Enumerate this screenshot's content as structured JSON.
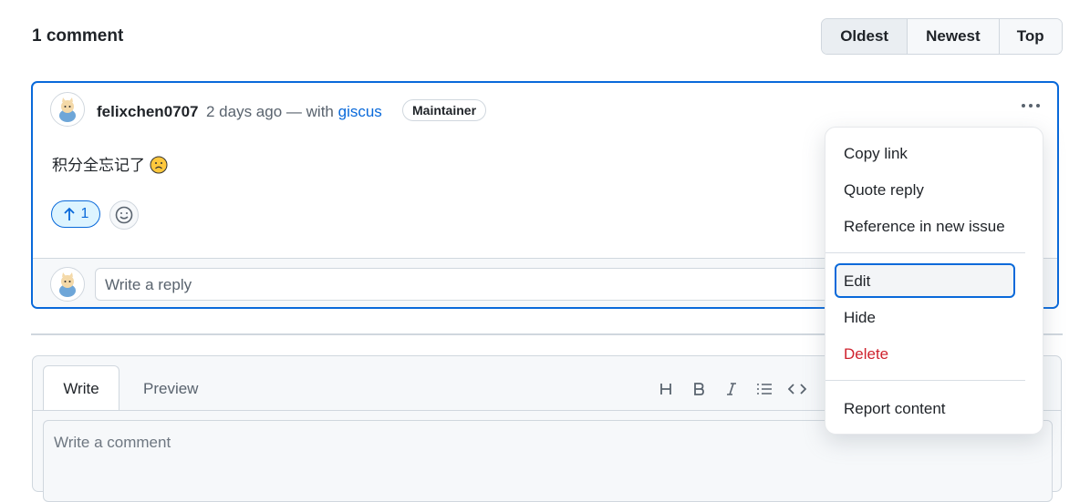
{
  "header": {
    "count_label": "1 comment"
  },
  "sort": {
    "options": [
      "Oldest",
      "Newest",
      "Top"
    ],
    "selected": "Oldest"
  },
  "comment": {
    "author": "felixchen0707",
    "time": "2 days ago",
    "via_text": "— with",
    "via_link": "giscus",
    "badge": "Maintainer",
    "body": "积分全忘记了",
    "upvote_count": "1"
  },
  "reply": {
    "placeholder": "Write a reply"
  },
  "editor": {
    "tabs": [
      "Write",
      "Preview"
    ],
    "placeholder": "Write a comment",
    "toolbar_icons": [
      "heading-icon",
      "bold-icon",
      "italic-icon",
      "list-icon",
      "code-icon"
    ]
  },
  "menu": {
    "items": [
      "Copy link",
      "Quote reply",
      "Reference in new issue",
      "Edit",
      "Hide",
      "Delete",
      "Report content"
    ]
  },
  "colors": {
    "accent": "#0969da",
    "danger": "#cf222e",
    "border": "#d0d7de"
  }
}
